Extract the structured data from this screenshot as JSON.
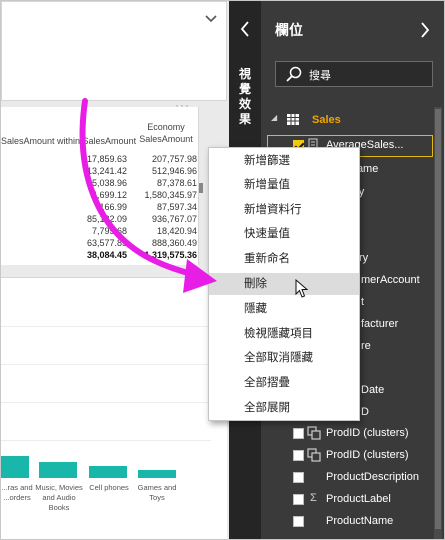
{
  "canvas": {
    "table": {
      "col1": "SalesAmount within SalesAmount",
      "col2": "Economy SalesAmount",
      "rows": [
        {
          "a": "17,859.63",
          "b": "207,757.98"
        },
        {
          "a": "13,241.42",
          "b": "512,946.96"
        },
        {
          "a": "5,038.96",
          "b": "87,378.61"
        },
        {
          "a": "4,699.12",
          "b": "1,580,345.97"
        },
        {
          "a": "166.99",
          "b": "87,597.34"
        },
        {
          "a": "85,182.09",
          "b": "936,767.07"
        },
        {
          "a": "7,795.68",
          "b": "18,420.94"
        },
        {
          "a": "63,577.85",
          "b": "888,360.49"
        }
      ],
      "total": {
        "a": "38,084.45",
        "b": "1,319,575.36"
      }
    },
    "chart": {
      "categories": [
        "...ras and ...orders",
        "Music, Movies and Audio Books",
        "Cell phones",
        "Games and Toys"
      ]
    }
  },
  "viz_pane": {
    "label": "視覺效果"
  },
  "fields_pane": {
    "title": "欄位",
    "search_placeholder": "搜尋",
    "table_name": "Sales",
    "fields": [
      {
        "label": "AverageSales...",
        "checked": true
      },
      {
        "label": "Name"
      },
      {
        "label": "ory"
      },
      {
        "label": ""
      },
      {
        "label": ""
      },
      {
        "label": "ry"
      },
      {
        "label": "merAccount"
      },
      {
        "label": "t"
      },
      {
        "label": "facturer"
      },
      {
        "label": "re"
      },
      {
        "label": ""
      },
      {
        "label": "Date"
      },
      {
        "label": "D"
      },
      {
        "label": "ProdID (clusters)"
      },
      {
        "label": "ProdID (clusters)"
      },
      {
        "label": "ProductDescription"
      },
      {
        "label": "ProductLabel"
      },
      {
        "label": "ProductName"
      }
    ]
  },
  "context_menu": {
    "items": [
      "新增篩選",
      "新增量值",
      "新增資料行",
      "快速量值",
      "重新命名",
      "刪除",
      "隱藏",
      "檢視隱藏項目",
      "全部取消隱藏",
      "全部摺疊",
      "全部展開"
    ],
    "highlighted": "刪除"
  },
  "colors": {
    "accent": "#f2c811",
    "table_name": "#f0a500",
    "bar": "#19b7a9",
    "arrow": "#e91ee6",
    "pane_bg": "#3a3a3a"
  }
}
